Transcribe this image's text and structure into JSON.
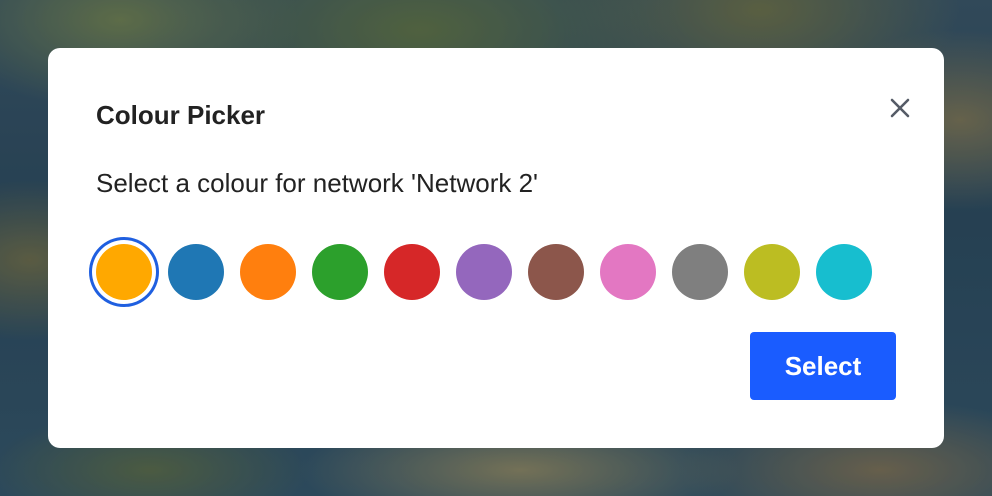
{
  "dialog": {
    "title": "Colour Picker",
    "message": "Select a colour for network 'Network 2'",
    "close_icon": "close-icon",
    "select_label": "Select",
    "selected_index": 0,
    "swatches": [
      {
        "name": "orange-yellow",
        "color": "#ffa800"
      },
      {
        "name": "blue",
        "color": "#1f77b4"
      },
      {
        "name": "orange",
        "color": "#ff7f0e"
      },
      {
        "name": "green",
        "color": "#2ca02c"
      },
      {
        "name": "red",
        "color": "#d62728"
      },
      {
        "name": "purple",
        "color": "#9467bd"
      },
      {
        "name": "brown",
        "color": "#8c564b"
      },
      {
        "name": "pink",
        "color": "#e377c2"
      },
      {
        "name": "gray",
        "color": "#7f7f7f"
      },
      {
        "name": "olive",
        "color": "#bcbd22"
      },
      {
        "name": "cyan",
        "color": "#17becf"
      }
    ],
    "accent_color": "#1a5cff"
  }
}
